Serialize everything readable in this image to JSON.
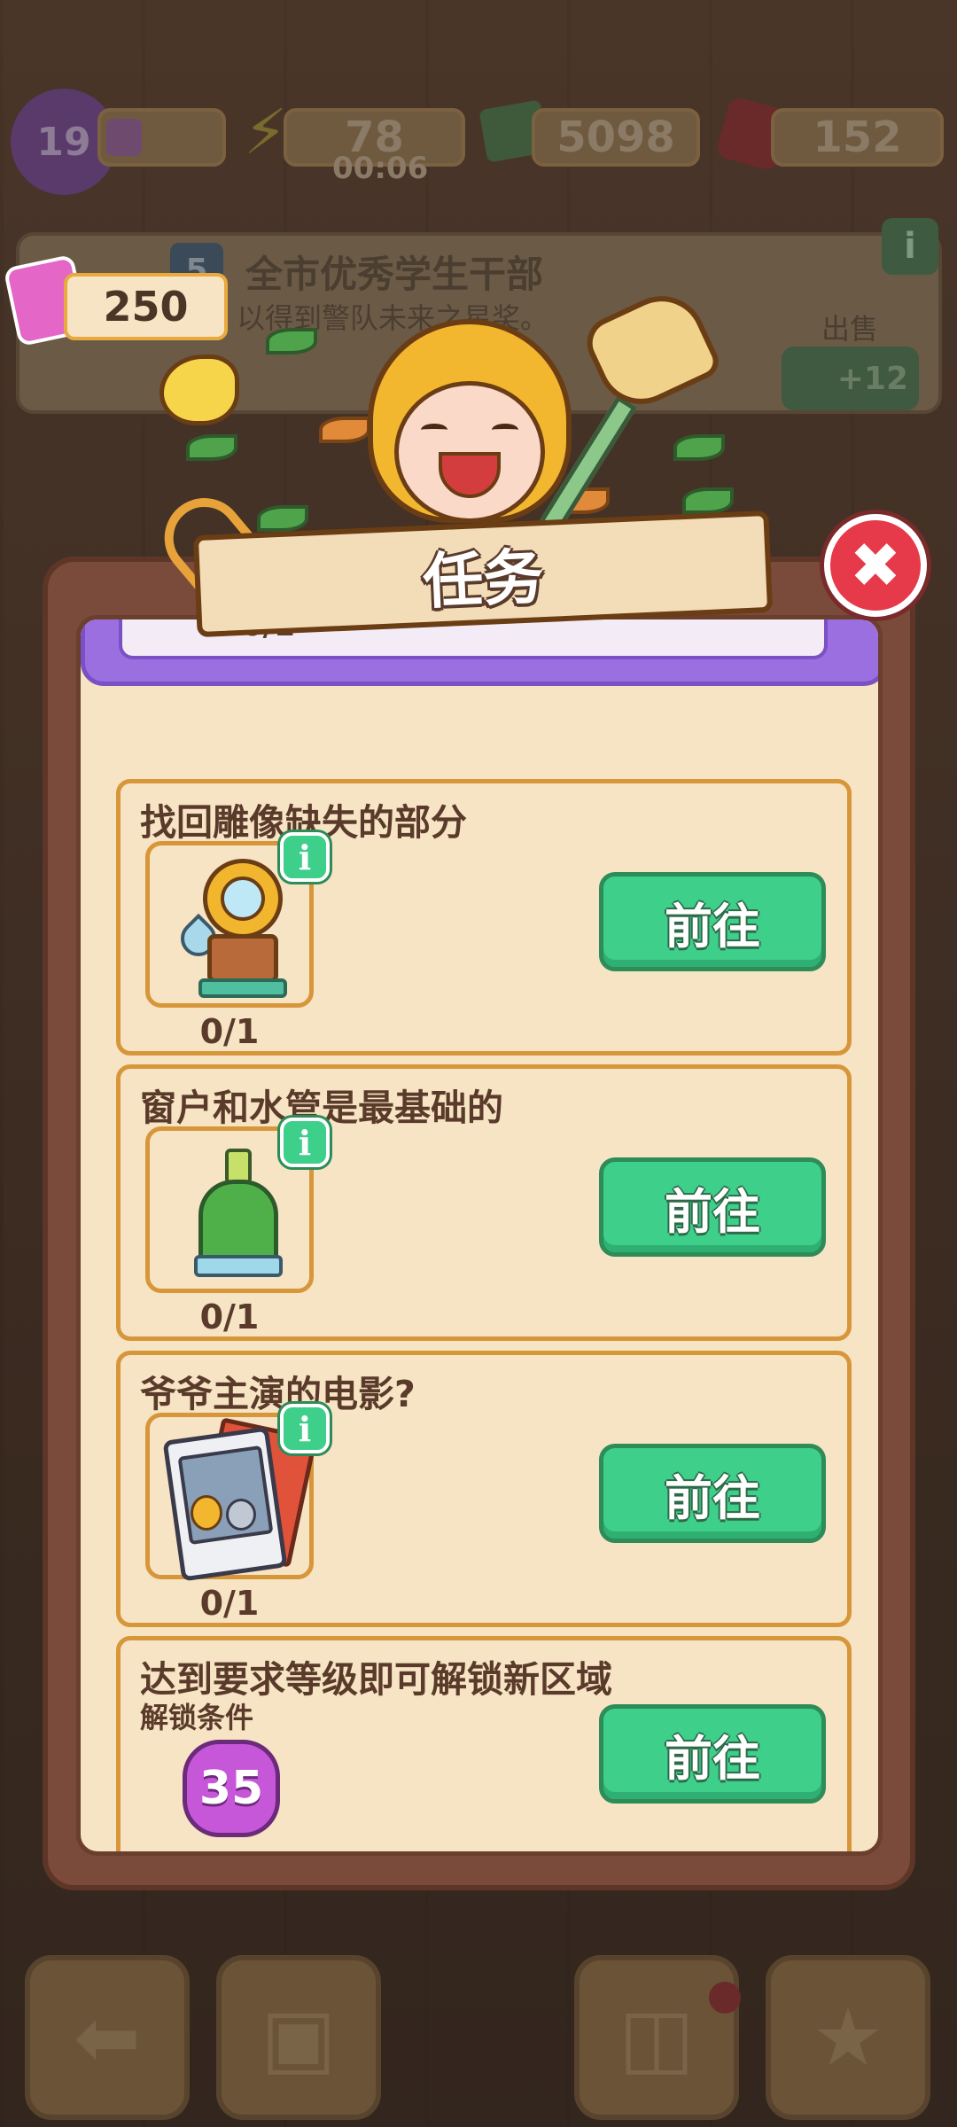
{
  "hud": {
    "level": "19",
    "energy": "78",
    "energy_timer": "00:06",
    "cash": "5098",
    "gems": "152"
  },
  "background_card": {
    "rank": "5",
    "title": "全市优秀学生干部",
    "description": "以得到警队未来之星奖。",
    "sell_label": "出售",
    "sell_value": "+12"
  },
  "tickets": "250",
  "modal": {
    "title": "任务",
    "peek_count": "0/1",
    "tasks": [
      {
        "title": "找回雕像缺失的部分",
        "count": "0/1",
        "icon": "statue-part-icon",
        "button": "前往"
      },
      {
        "title": "窗户和水管是最基础的",
        "count": "0/1",
        "icon": "brush-icon",
        "button": "前往"
      },
      {
        "title": "爷爷主演的电影?",
        "count": "0/1",
        "icon": "movie-photo-icon",
        "button": "前往"
      },
      {
        "title": "达到要求等级即可解锁新区域",
        "sub_label": "解锁条件",
        "required_level": "35",
        "button": "前往"
      }
    ]
  },
  "colors": {
    "button_green": "#3ecf8a",
    "close_red": "#e63a4a",
    "panel_cream": "#f6e4c4",
    "task_border": "#d8963a",
    "level_purple": "#c657d8"
  }
}
